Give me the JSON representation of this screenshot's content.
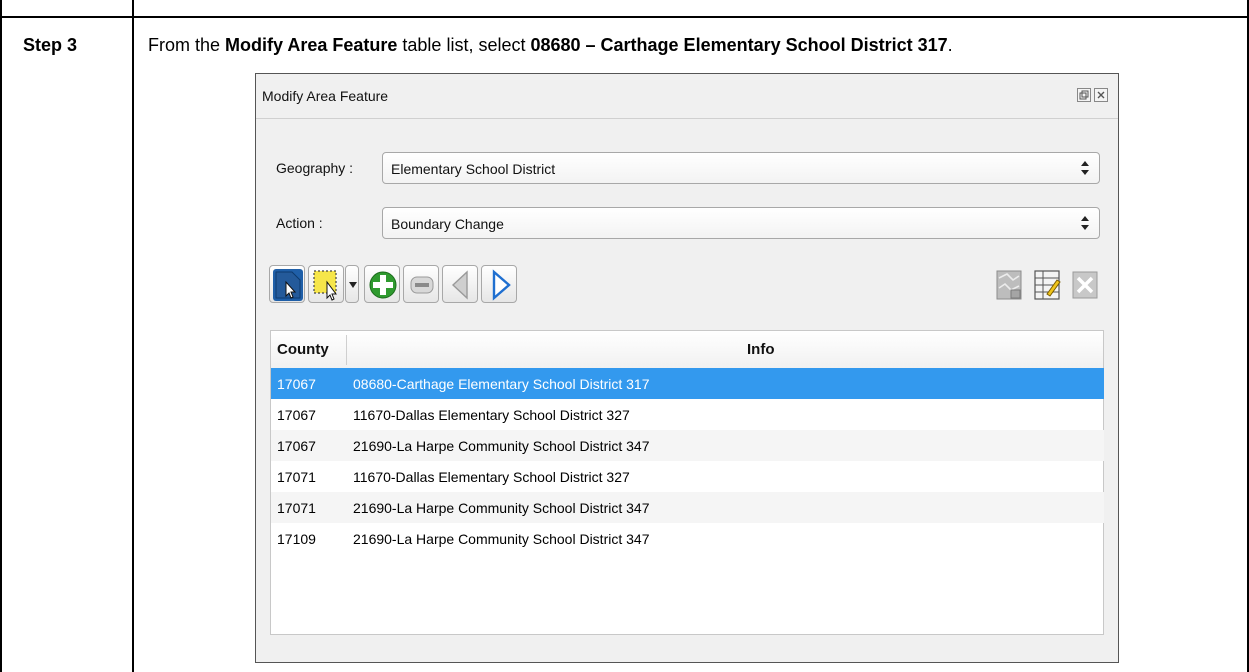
{
  "step": {
    "label": "Step 3",
    "instruction": {
      "prefix": "From the ",
      "bold1": "Modify Area Feature",
      "middle": " table list, select ",
      "bold2": "08680 – Carthage Elementary School District 317",
      "suffix": "."
    }
  },
  "dialog": {
    "title": "Modify Area Feature",
    "float_icon": "float-icon",
    "close_icon": "close-icon",
    "geography": {
      "label": "Geography :",
      "value": "Elementary School District"
    },
    "action": {
      "label": "Action :",
      "value": "Boundary Change"
    },
    "toolbar_icons": [
      "select-feature-icon",
      "rectangle-select-icon",
      "dropdown-arrow-icon",
      "add-icon",
      "remove-icon",
      "previous-icon",
      "next-icon",
      "map-icon",
      "edit-table-icon",
      "clear-icon"
    ],
    "table": {
      "columns": [
        "County",
        "Info"
      ],
      "rows": [
        {
          "county": "17067",
          "info": "08680-Carthage Elementary School District 317",
          "selected": true
        },
        {
          "county": "17067",
          "info": "11670-Dallas Elementary School District 327",
          "selected": false
        },
        {
          "county": "17067",
          "info": "21690-La Harpe Community School District 347",
          "selected": false
        },
        {
          "county": "17071",
          "info": "11670-Dallas Elementary School District 327",
          "selected": false
        },
        {
          "county": "17071",
          "info": "21690-La Harpe Community School District 347",
          "selected": false
        },
        {
          "county": "17109",
          "info": "21690-La Harpe Community School District 347",
          "selected": false
        }
      ]
    }
  },
  "colors": {
    "selection": "#3399ee",
    "add_green": "#2f9a2f",
    "next_blue": "#1f6fd0"
  }
}
